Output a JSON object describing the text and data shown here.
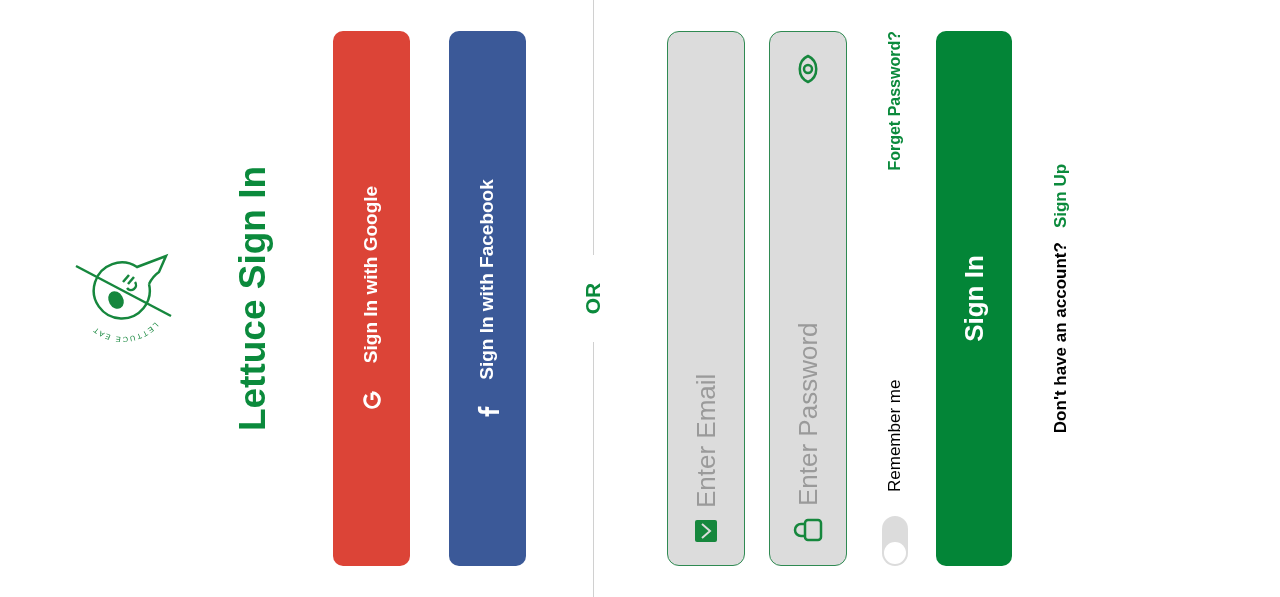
{
  "logo": {
    "caption": "LETTUCE EAT"
  },
  "title": "Lettuce Sign In",
  "social_buttons": [
    {
      "kind": "google",
      "label": "Sign In with Google"
    },
    {
      "kind": "facebook",
      "label": "Sign In with Facebook"
    }
  ],
  "divider": "OR",
  "fields": [
    {
      "kind": "email",
      "placeholder": "Enter Email"
    },
    {
      "kind": "password",
      "placeholder": "Enter Password"
    }
  ],
  "remember_me": {
    "label": "Remember me",
    "on": false
  },
  "forgot_link": "Forget Password?",
  "sign_in_button": "Sign In",
  "footer": {
    "prompt": "Don't have an account?",
    "link": "Sign Up"
  }
}
